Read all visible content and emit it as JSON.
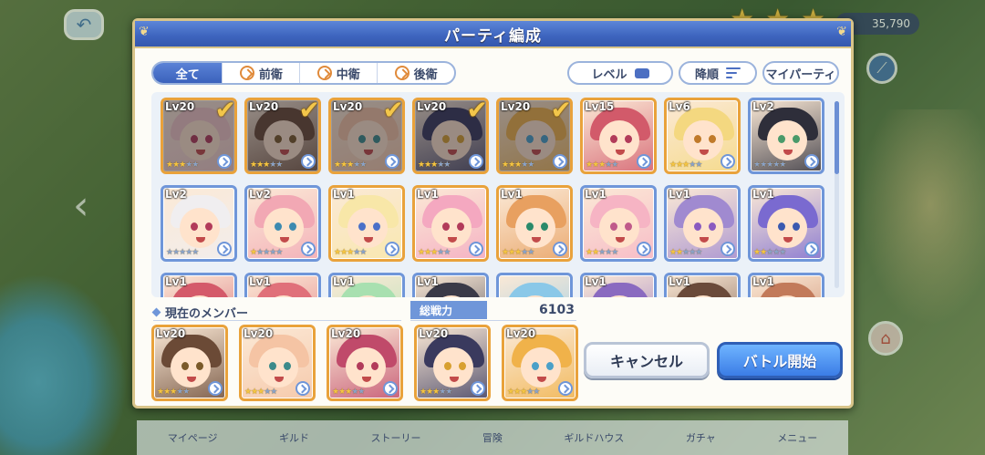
{
  "dialog": {
    "title": "パーティ編成"
  },
  "filters": {
    "tabs": [
      {
        "label": "全て",
        "active": true
      },
      {
        "label": "前衛",
        "active": false
      },
      {
        "label": "中衛",
        "active": false
      },
      {
        "label": "後衛",
        "active": false
      }
    ],
    "level_label": "レベル",
    "sort_label": "降順",
    "my_party_label": "マイパーティ"
  },
  "roster": [
    {
      "level": "Lv20",
      "stars": 3,
      "selected": true,
      "hair": "#f2c7c7",
      "eyes": "#b23b5a"
    },
    {
      "level": "Lv20",
      "stars": 3,
      "selected": true,
      "hair": "#6b4a36",
      "eyes": "#7a5a2a"
    },
    {
      "level": "Lv20",
      "stars": 3,
      "selected": true,
      "hair": "#f5c4a4",
      "eyes": "#3c8a8a"
    },
    {
      "level": "Lv20",
      "stars": 3,
      "selected": true,
      "hair": "#3a3a5e",
      "eyes": "#d8a030"
    },
    {
      "level": "Lv20",
      "stars": 3,
      "selected": true,
      "hair": "#f0b24a",
      "eyes": "#4aa0c8"
    },
    {
      "level": "Lv15",
      "stars": 3,
      "selected": false,
      "hair": "#d25a6a",
      "eyes": "#b23b5a"
    },
    {
      "level": "Lv6",
      "stars": 3,
      "selected": false,
      "hair": "#f4d880",
      "eyes": "#c07a2a"
    },
    {
      "level": "Lv2",
      "stars": 0,
      "selected": false,
      "hair": "#2e2e3a",
      "eyes": "#4a9a6a"
    },
    {
      "level": "Lv2",
      "stars": 0,
      "selected": false,
      "hair": "#f0eef0",
      "eyes": "#b23b5a"
    },
    {
      "level": "Lv2",
      "stars": 1,
      "selected": false,
      "hair": "#f2a8b4",
      "eyes": "#3c8ab0"
    },
    {
      "level": "Lv1",
      "stars": 3,
      "selected": false,
      "hair": "#f8e7a8",
      "eyes": "#4a70c8"
    },
    {
      "level": "Lv1",
      "stars": 3,
      "selected": false,
      "hair": "#f4a8c0",
      "eyes": "#b23b5a"
    },
    {
      "level": "Lv1",
      "stars": 3,
      "selected": false,
      "hair": "#e8a060",
      "eyes": "#2a8a6a"
    },
    {
      "level": "Lv1",
      "stars": 2,
      "selected": false,
      "hair": "#f6b4c4",
      "eyes": "#c05a8a"
    },
    {
      "level": "Lv1",
      "stars": 2,
      "selected": false,
      "hair": "#a08ad0",
      "eyes": "#8a5ac0"
    },
    {
      "level": "Lv1",
      "stars": 2,
      "selected": false,
      "hair": "#7a6ad0",
      "eyes": "#3a5ab0"
    },
    {
      "level": "Lv1",
      "stars": 0,
      "selected": false,
      "hair": "#d45a6a",
      "eyes": "#b23b5a"
    },
    {
      "level": "Lv1",
      "stars": 0,
      "selected": false,
      "hair": "#e0707a",
      "eyes": "#b23b5a"
    },
    {
      "level": "Lv1",
      "stars": 0,
      "selected": false,
      "hair": "#a8e0b0",
      "eyes": "#3a8a5a"
    },
    {
      "level": "Lv1",
      "stars": 0,
      "selected": false,
      "hair": "#3a3a48",
      "eyes": "#8a5ac0"
    },
    {
      "level": "",
      "stars": 0,
      "selected": false,
      "hair": "#8ac8e8",
      "eyes": "#3a7ab0"
    },
    {
      "level": "Lv1",
      "stars": 0,
      "selected": false,
      "hair": "#8a6ac0",
      "eyes": "#5a3a9a"
    },
    {
      "level": "Lv1",
      "stars": 0,
      "selected": false,
      "hair": "#6a4a3a",
      "eyes": "#8a5a2a"
    },
    {
      "level": "Lv1",
      "stars": 0,
      "selected": false,
      "hair": "#c27a5a",
      "eyes": "#8a4a2a"
    }
  ],
  "current_members": {
    "label": "現在のメンバー",
    "power_label": "総戦力",
    "power_value": "6103",
    "members": [
      {
        "level": "Lv20",
        "stars": 3,
        "hair": "#6b4a36",
        "eyes": "#7a5a2a"
      },
      {
        "level": "Lv20",
        "stars": 3,
        "hair": "#f5c4a4",
        "eyes": "#3c8a8a"
      },
      {
        "level": "Lv20",
        "stars": 3,
        "hair": "#c04a6a",
        "eyes": "#b23b5a"
      },
      {
        "level": "Lv20",
        "stars": 3,
        "hair": "#3a3a5e",
        "eyes": "#d8a030"
      },
      {
        "level": "Lv20",
        "stars": 3,
        "hair": "#f0b24a",
        "eyes": "#4aa0c8"
      }
    ]
  },
  "buttons": {
    "cancel": "キャンセル",
    "start": "バトル開始"
  },
  "background": {
    "counter": "35,790",
    "menu": [
      "マイページ",
      "ギルド",
      "ストーリー",
      "冒険",
      "ギルドハウス",
      "ガチャ",
      "メニュー"
    ]
  },
  "colors": {
    "accent": "#3d64be",
    "gold": "#f3c64a",
    "frame_gold": "#d8c489"
  }
}
